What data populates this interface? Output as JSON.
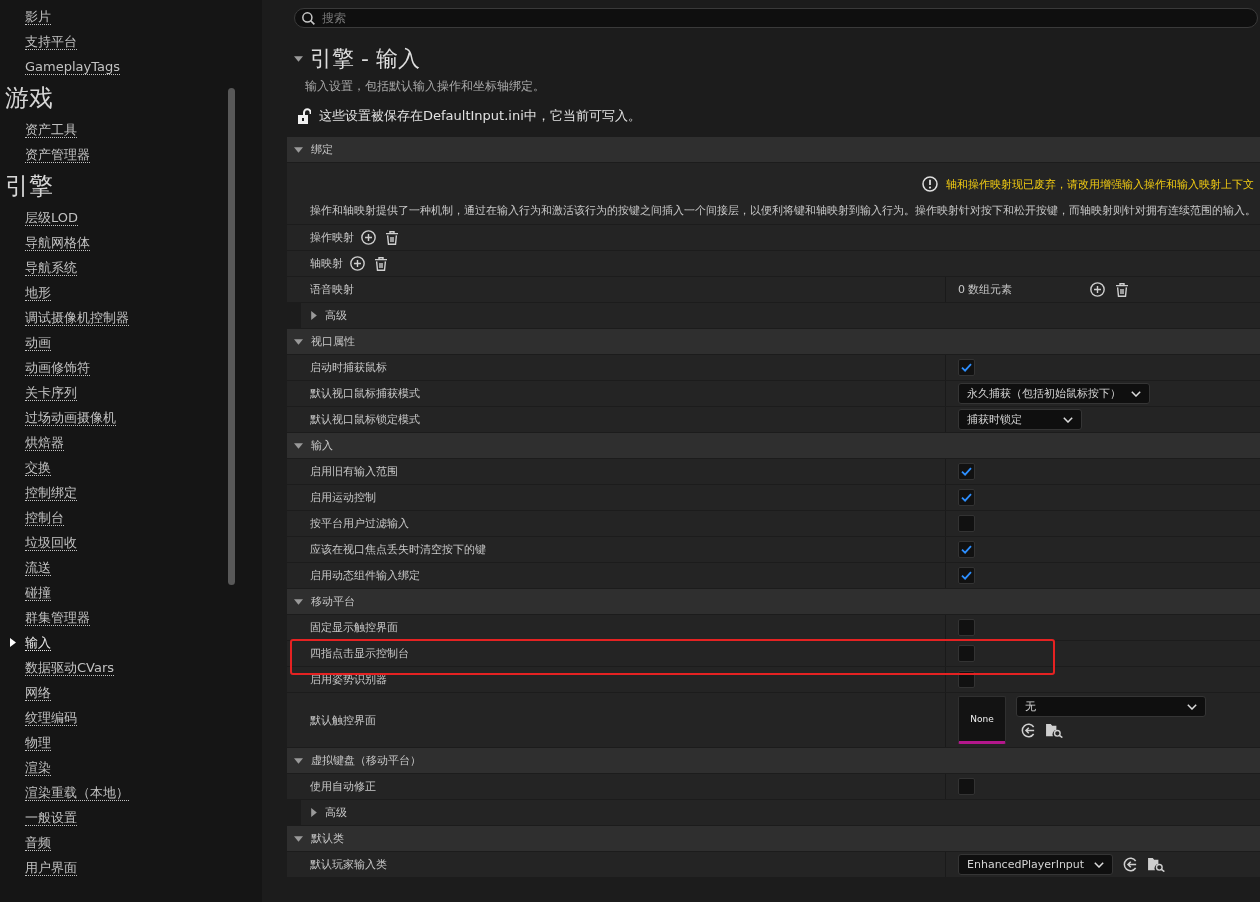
{
  "sidebar": {
    "groups": [
      {
        "items": [
          {
            "label": "影片",
            "selected": false
          },
          {
            "label": "支持平台",
            "selected": false
          },
          {
            "label": "GameplayTags",
            "selected": false
          }
        ]
      },
      {
        "heading": "游戏",
        "items": [
          {
            "label": "资产工具",
            "selected": false
          },
          {
            "label": "资产管理器",
            "selected": false
          }
        ]
      },
      {
        "heading": "引擎",
        "items": [
          {
            "label": "层级LOD",
            "selected": false
          },
          {
            "label": "导航网格体",
            "selected": false
          },
          {
            "label": "导航系统",
            "selected": false
          },
          {
            "label": "地形",
            "selected": false
          },
          {
            "label": "调试摄像机控制器",
            "selected": false
          },
          {
            "label": "动画",
            "selected": false
          },
          {
            "label": "动画修饰符",
            "selected": false
          },
          {
            "label": "关卡序列",
            "selected": false
          },
          {
            "label": "过场动画摄像机",
            "selected": false
          },
          {
            "label": "烘焙器",
            "selected": false
          },
          {
            "label": "交换",
            "selected": false
          },
          {
            "label": "控制绑定",
            "selected": false
          },
          {
            "label": "控制台",
            "selected": false
          },
          {
            "label": "垃圾回收",
            "selected": false
          },
          {
            "label": "流送",
            "selected": false
          },
          {
            "label": "碰撞",
            "selected": false
          },
          {
            "label": "群集管理器",
            "selected": false
          },
          {
            "label": "输入",
            "selected": true
          },
          {
            "label": "数据驱动CVars",
            "selected": false
          },
          {
            "label": "网络",
            "selected": false
          },
          {
            "label": "纹理编码",
            "selected": false
          },
          {
            "label": "物理",
            "selected": false
          },
          {
            "label": "渲染",
            "selected": false
          },
          {
            "label": "渲染重载（本地）",
            "selected": false
          },
          {
            "label": "一般设置",
            "selected": false
          },
          {
            "label": "音频",
            "selected": false
          },
          {
            "label": "用户界面",
            "selected": false
          }
        ]
      }
    ]
  },
  "search": {
    "placeholder": "搜索"
  },
  "page": {
    "title": "引擎 - 输入",
    "expanded": true,
    "description": "输入设置，包括默认输入操作和坐标轴绑定。",
    "storage_note": "这些设置被保存在DefaultInput.ini中，它当前可写入。",
    "locked": false
  },
  "sections": [
    {
      "title": "绑定",
      "expanded": true,
      "rows": [
        {
          "kind": "notice",
          "warning": "轴和操作映射现已废弃，请改用增强输入操作和输入映射上下文",
          "text": "操作和轴映射提供了一种机制，通过在输入行为和激活该行为的按键之间插入一个间接层，以便利将键和轴映射到输入行为。操作映射针对按下和松开按键，而轴映射则针对拥有连续范围的输入。",
          "highlighted": false
        },
        {
          "kind": "mapping",
          "label": "操作映射",
          "highlighted": false
        },
        {
          "kind": "mapping",
          "label": "轴映射",
          "highlighted": false
        },
        {
          "kind": "array",
          "label": "语音映射",
          "value": "0 数组元素",
          "highlighted": false
        },
        {
          "kind": "group",
          "label": "高级",
          "expanded": false,
          "highlighted": false
        }
      ]
    },
    {
      "title": "视口属性",
      "expanded": true,
      "rows": [
        {
          "kind": "checkbox",
          "label": "启动时捕获鼠标",
          "checked": true,
          "highlighted": false
        },
        {
          "kind": "dropdown",
          "label": "默认视口鼠标捕获模式",
          "value": "永久捕获（包括初始鼠标按下）",
          "highlighted": false
        },
        {
          "kind": "dropdown",
          "label": "默认视口鼠标锁定模式",
          "value": "捕获时锁定",
          "highlighted": false
        }
      ]
    },
    {
      "title": "输入",
      "expanded": true,
      "rows": [
        {
          "kind": "checkbox",
          "label": "启用旧有输入范围",
          "checked": true,
          "highlighted": false
        },
        {
          "kind": "checkbox",
          "label": "启用运动控制",
          "checked": true,
          "highlighted": false
        },
        {
          "kind": "checkbox",
          "label": "按平台用户过滤输入",
          "checked": false,
          "highlighted": false
        },
        {
          "kind": "checkbox",
          "label": "应该在视口焦点丢失时清空按下的键",
          "checked": true,
          "highlighted": false
        },
        {
          "kind": "checkbox",
          "label": "启用动态组件输入绑定",
          "checked": true,
          "highlighted": false
        }
      ]
    },
    {
      "title": "移动平台",
      "expanded": true,
      "rows": [
        {
          "kind": "checkbox",
          "label": "固定显示触控界面",
          "checked": false,
          "highlighted": false
        },
        {
          "kind": "checkbox",
          "label": "四指点击显示控制台",
          "checked": false,
          "highlighted": true
        },
        {
          "kind": "checkbox",
          "label": "启用姿势识别器",
          "checked": false,
          "highlighted": false
        },
        {
          "kind": "asset",
          "label": "默认触控界面",
          "thumbnail": "None",
          "value": "无",
          "highlighted": false
        }
      ]
    },
    {
      "title": "虚拟键盘（移动平台）",
      "expanded": true,
      "rows": [
        {
          "kind": "checkbox",
          "label": "使用自动修正",
          "checked": false,
          "highlighted": false
        },
        {
          "kind": "group",
          "label": "高级",
          "expanded": false,
          "highlighted": false
        }
      ]
    },
    {
      "title": "默认类",
      "expanded": true,
      "rows": [
        {
          "kind": "class",
          "label": "默认玩家输入类",
          "value": "EnhancedPlayerInput",
          "highlighted": false
        }
      ]
    }
  ]
}
